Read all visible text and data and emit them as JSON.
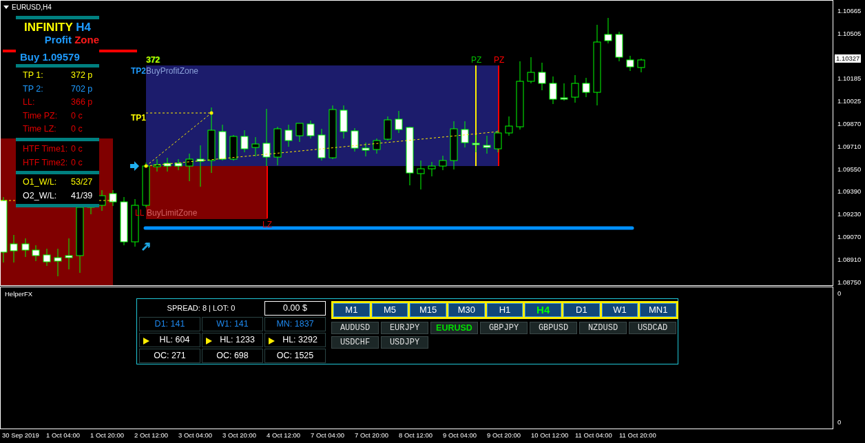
{
  "chart": {
    "title": "EURUSD,H4",
    "indicator": {
      "title": [
        {
          "text": "INFINITY",
          "color": "#ffff00"
        },
        {
          "text": "H4",
          "color": "#1e9bff"
        }
      ],
      "subtitle": [
        {
          "text": "Profit",
          "color": "#1e9bff"
        },
        {
          "text": "Zone",
          "color": "#ff1a1a"
        }
      ],
      "signal": "Buy 1.09579",
      "sections": [
        [
          {
            "label": "TP 1:",
            "value": "372 p",
            "color": "#ffff00"
          },
          {
            "label": "TP 2:",
            "value": "702 p",
            "color": "#1e9bff"
          },
          {
            "label": "LL:",
            "value": "366 p",
            "color": "#e00000"
          },
          {
            "label": "Time PZ:",
            "value": "0 c",
            "color": "#e00000"
          },
          {
            "label": "Time LZ:",
            "value": "0 c",
            "color": "#e00000"
          }
        ],
        [
          {
            "label": "HTF Time1:",
            "value": "0 c",
            "color": "#e00000"
          },
          {
            "label": "HTF Time2:",
            "value": "0 c",
            "color": "#e00000"
          }
        ],
        [
          {
            "label": "O1_W/L:",
            "value": "53/27",
            "color": "#ffff00"
          },
          {
            "label": "O2_W/L:",
            "value": "41/39",
            "color": "#ffffff"
          }
        ]
      ]
    },
    "profit_zone": {
      "count": "372",
      "tp2": "TP2",
      "name": "BuyProfitZone",
      "tp1": "TP1",
      "markers": [
        {
          "text": "PZ",
          "color": "#00c000"
        },
        {
          "text": "PZ",
          "color": "#ff0000"
        }
      ]
    },
    "limit_zone": {
      "ll": "LL",
      "name": "BuyLimitZone",
      "marker": "LZ"
    },
    "price_axis": [
      "1.10665",
      "1.10505",
      "1.10185",
      "1.10025",
      "1.09870",
      "1.09710",
      "1.09550",
      "1.09390",
      "1.09230",
      "1.09070",
      "1.08910",
      "1.08750"
    ],
    "current_price": "1.10327"
  },
  "subwindow": {
    "title": "HelperFX",
    "axis": [
      "0",
      "0"
    ],
    "helper": {
      "spread": "SPREAD: 8 | LOT: 0",
      "balance": "0.00 $",
      "rows": [
        {
          "kind": "range",
          "cells": [
            "D1: 141",
            "W1: 141",
            "MN: 1837"
          ]
        },
        {
          "kind": "hl",
          "cells": [
            "HL: 604",
            "HL: 1233",
            "HL: 3292"
          ]
        },
        {
          "kind": "oc",
          "cells": [
            "OC: 271",
            "OC: 698",
            "OC: 1525"
          ]
        }
      ],
      "timeframes": [
        {
          "label": "M1",
          "selected": false
        },
        {
          "label": "M5",
          "selected": false
        },
        {
          "label": "M15",
          "selected": false
        },
        {
          "label": "M30",
          "selected": false
        },
        {
          "label": "H1",
          "selected": false
        },
        {
          "label": "H4",
          "selected": true
        },
        {
          "label": "D1",
          "selected": false
        },
        {
          "label": "W1",
          "selected": false
        },
        {
          "label": "MN1",
          "selected": false
        }
      ],
      "symbols": [
        {
          "label": "AUDUSD",
          "selected": false
        },
        {
          "label": "EURJPY",
          "selected": false
        },
        {
          "label": "EURUSD",
          "selected": true
        },
        {
          "label": "GBPJPY",
          "selected": false
        },
        {
          "label": "GBPUSD",
          "selected": false
        },
        {
          "label": "NZDUSD",
          "selected": false
        },
        {
          "label": "USDCAD",
          "selected": false
        },
        {
          "label": "USDCHF",
          "selected": false
        },
        {
          "label": "USDJPY",
          "selected": false
        }
      ]
    }
  },
  "time_axis": [
    "30 Sep 2019",
    "1 Oct 04:00",
    "1 Oct 20:00",
    "2 Oct 12:00",
    "3 Oct 04:00",
    "3 Oct 20:00",
    "4 Oct 12:00",
    "7 Oct 04:00",
    "7 Oct 20:00",
    "8 Oct 12:00",
    "9 Oct 04:00",
    "9 Oct 20:00",
    "10 Oct 12:00",
    "11 Oct 04:00",
    "11 Oct 20:00"
  ]
}
